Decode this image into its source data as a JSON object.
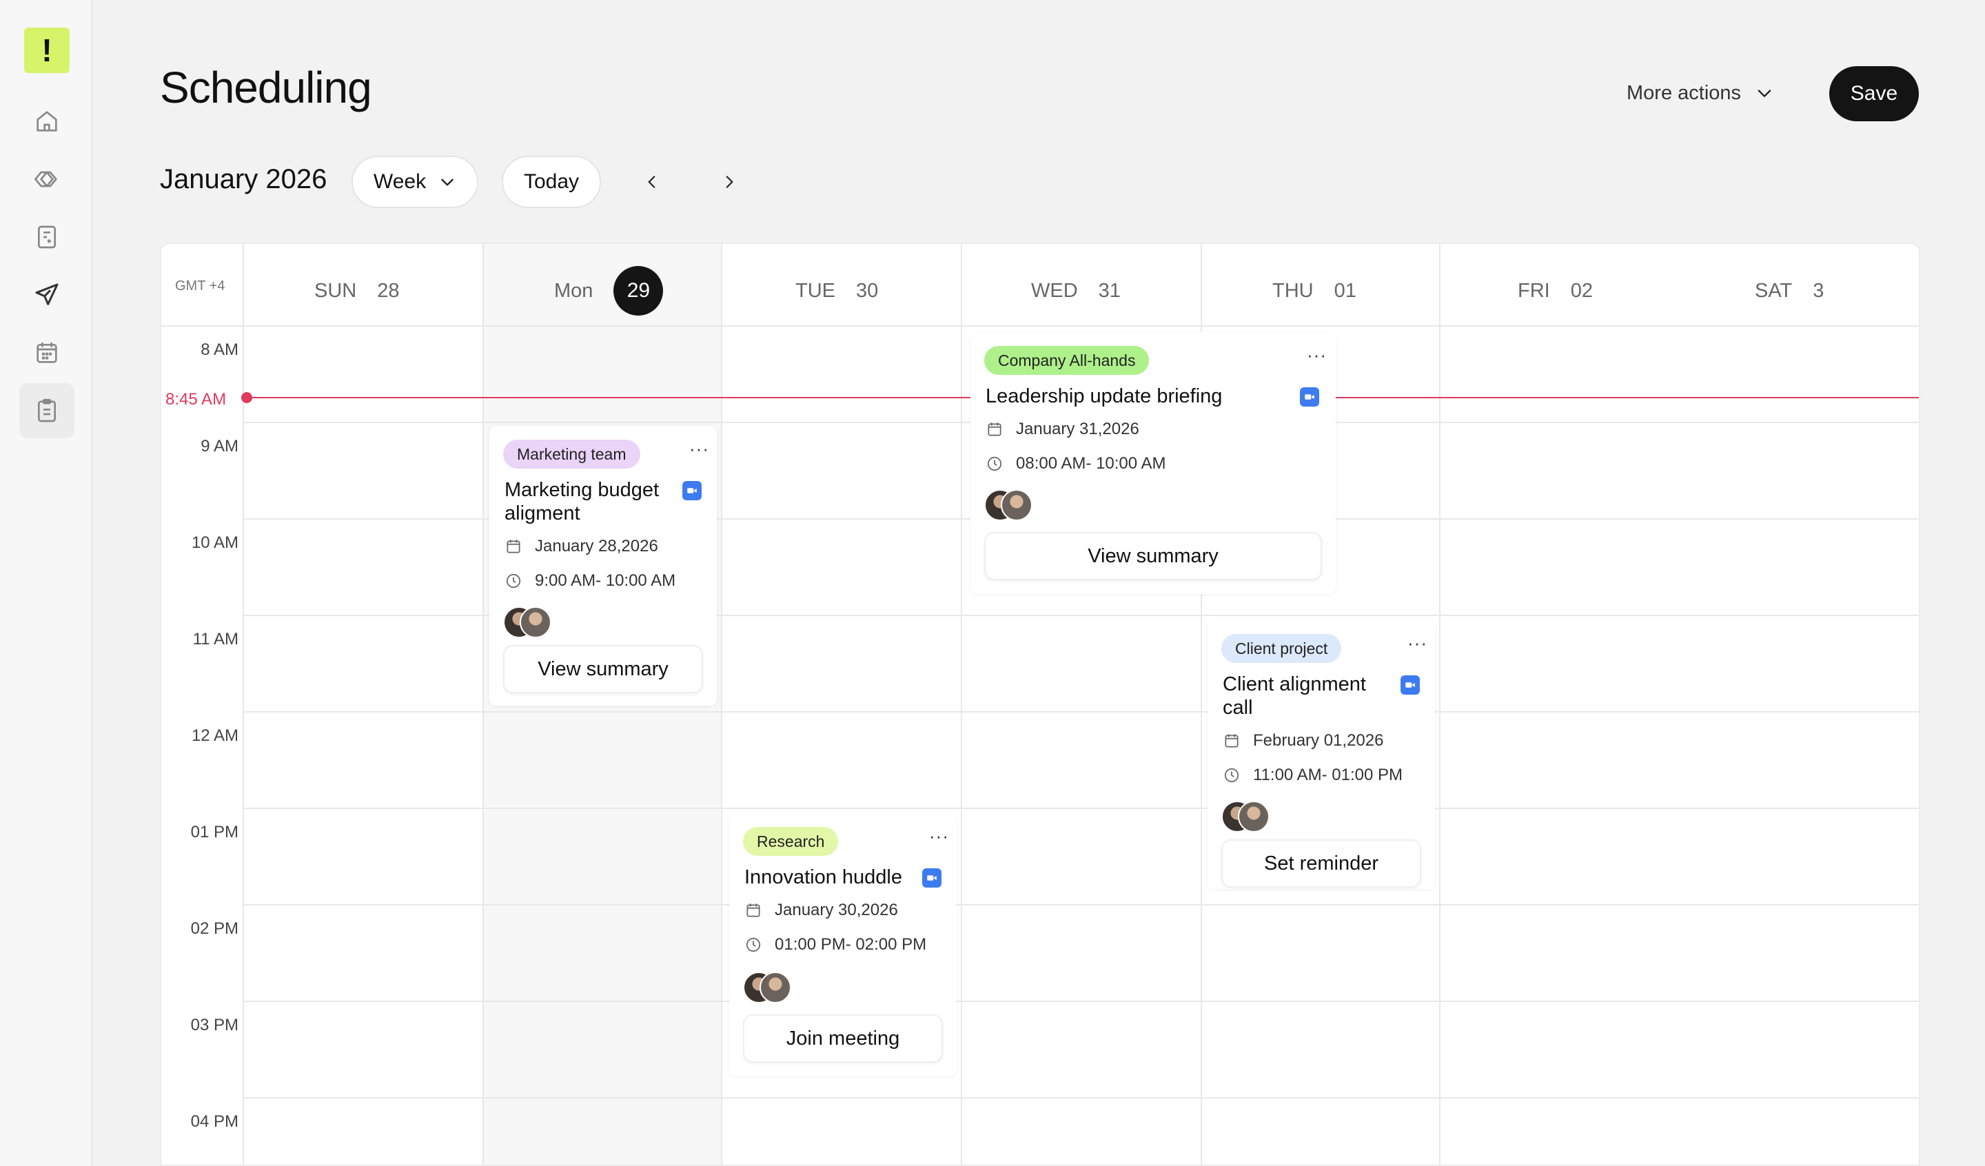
{
  "sidebar": {
    "logo_text": "!",
    "items": [
      {
        "icon": "home-icon",
        "active": false
      },
      {
        "icon": "double-chevron-icon",
        "active": false
      },
      {
        "icon": "invoice-icon",
        "active": false
      },
      {
        "icon": "send-icon",
        "active": false
      },
      {
        "icon": "calendar-icon",
        "active": false
      },
      {
        "icon": "clipboard-icon",
        "active": true
      }
    ],
    "accent_color": "#d6f36a"
  },
  "header": {
    "title": "Scheduling",
    "more_actions_label": "More actions",
    "save_label": "Save"
  },
  "toolbar": {
    "month_label": "January 2026",
    "view_label": "Week",
    "today_label": "Today"
  },
  "calendar": {
    "timezone": "GMT +4",
    "days": [
      {
        "name": "SUN",
        "num": "28"
      },
      {
        "name": "Mon",
        "num": "29",
        "today": true
      },
      {
        "name": "TUE",
        "num": "30"
      },
      {
        "name": "WED",
        "num": "31"
      },
      {
        "name": "THU",
        "num": "01"
      },
      {
        "name": "FRI",
        "num": "02"
      },
      {
        "name": "SAT",
        "num": "3"
      }
    ],
    "time_slots": [
      "8 AM",
      "9 AM",
      "10 AM",
      "11 AM",
      "12 AM",
      "01 PM",
      "02 PM",
      "03 PM",
      "04 PM"
    ],
    "now_label": "8:45 AM",
    "now_color": "#e03a5e"
  },
  "events": [
    {
      "tag": "Marketing team",
      "tag_color": "#ead4f8",
      "title_line1": "Marketing budget",
      "title_line2": "aligment",
      "date": "January 28,2026",
      "time": "9:00 AM- 10:00 AM",
      "action": "View summary"
    },
    {
      "tag": "Company All-hands",
      "tag_color": "#aef08a",
      "title_line1": "Leadership update briefing",
      "date": "January 31,2026",
      "time": "08:00 AM- 10:00 AM",
      "action": "View summary"
    },
    {
      "tag": "Client project",
      "tag_color": "#dce8fb",
      "title_line1": "Client alignment",
      "title_line2": "call",
      "date": "February 01,2026",
      "time": "11:00 AM- 01:00 PM",
      "action": "Set reminder"
    },
    {
      "tag": "Research",
      "tag_color": "#e3f7a8",
      "title_line1": "Innovation huddle",
      "date": "January 30,2026",
      "time": "01:00 PM- 02:00 PM",
      "action": "Join meeting"
    }
  ],
  "icons": {
    "menu": "more-dots-icon",
    "video": "video-camera-icon",
    "date": "calendar-icon",
    "time": "clock-icon"
  },
  "more_glyph": "···"
}
